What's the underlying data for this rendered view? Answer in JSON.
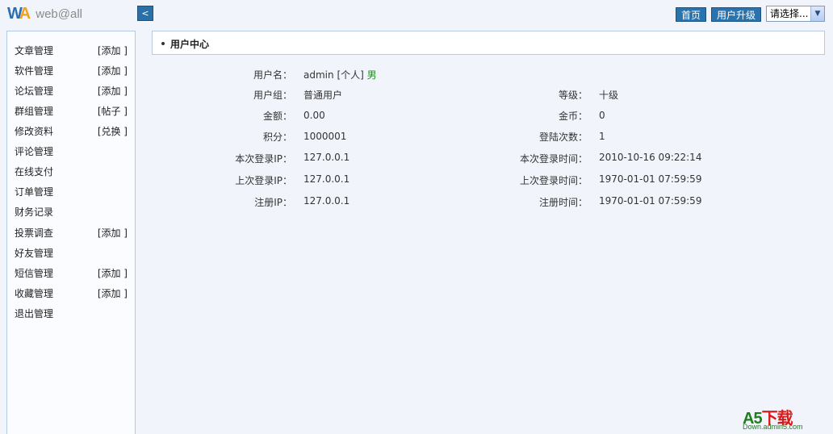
{
  "header": {
    "logo_mark_w": "W",
    "logo_mark_a": "A",
    "logo_text": "web@all",
    "collapse_label": "<",
    "nav": [
      {
        "label": "首页"
      },
      {
        "label": "用户升级"
      }
    ],
    "select_value": "请选择..."
  },
  "sidebar": {
    "items": [
      {
        "label": "文章管理",
        "action": "[添加 ]"
      },
      {
        "label": "软件管理",
        "action": "[添加 ]"
      },
      {
        "label": "论坛管理",
        "action": "[添加 ]"
      },
      {
        "label": "群组管理",
        "action": "[帖子 ]"
      },
      {
        "label": "修改资料",
        "action": "[兑换 ]"
      },
      {
        "label": "评论管理",
        "action": ""
      },
      {
        "label": "在线支付",
        "action": ""
      },
      {
        "label": "订单管理",
        "action": ""
      },
      {
        "label": "财务记录",
        "action": ""
      },
      {
        "label": "投票调查",
        "action": "[添加 ]"
      },
      {
        "label": "好友管理",
        "action": ""
      },
      {
        "label": "短信管理",
        "action": "[添加 ]"
      },
      {
        "label": "收藏管理",
        "action": "[添加 ]"
      },
      {
        "label": "退出管理",
        "action": ""
      }
    ]
  },
  "panel": {
    "title": "用户中心"
  },
  "user_info": {
    "username_label": "用户名：",
    "username": "admin",
    "user_type": "[个人]",
    "gender": "男",
    "left": [
      {
        "label": "用户组：",
        "value": "普通用户"
      },
      {
        "label": "金额：",
        "value": "0.00"
      },
      {
        "label": "积分：",
        "value": "1000001"
      },
      {
        "label": "本次登录IP：",
        "value": "127.0.0.1"
      },
      {
        "label": "上次登录IP：",
        "value": "127.0.0.1"
      },
      {
        "label": "注册IP：",
        "value": "127.0.0.1"
      }
    ],
    "right": [
      {
        "label": "等级：",
        "value": "十级"
      },
      {
        "label": "金币：",
        "value": "0"
      },
      {
        "label": "登陆次数：",
        "value": "1"
      },
      {
        "label": "本次登录时间：",
        "value": "2010-10-16 09:22:14"
      },
      {
        "label": "上次登录时间：",
        "value": "1970-01-01 07:59:59"
      },
      {
        "label": "注册时间：",
        "value": "1970-01-01 07:59:59"
      }
    ]
  },
  "watermark": {
    "brand_a5": "A5",
    "brand_xz": "下载",
    "url": "Down.admin5.com"
  }
}
